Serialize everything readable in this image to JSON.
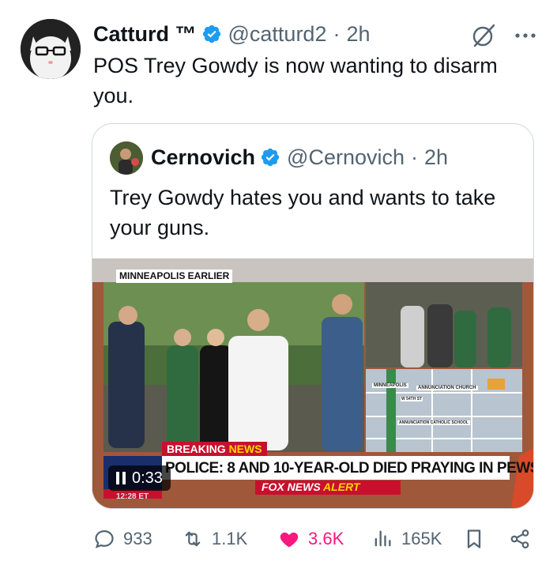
{
  "tweet": {
    "author_name": "Catturd ™",
    "handle": "@catturd2",
    "separator": "·",
    "time": "2h",
    "text": "POS Trey Gowdy is now wanting to disarm you."
  },
  "quote": {
    "author_name": "Cernovich",
    "handle": "@Cernovich",
    "separator": "·",
    "time": "2h",
    "text": "Trey Gowdy hates you and wants to take your guns.",
    "video": {
      "location_tag": "MINNEAPOLIS EARLIER",
      "breaking_label_1": "BREAKING",
      "breaking_label_2": "NEWS",
      "headline": "POLICE: 8 AND 10-YEAR-OLD DIED PRAYING IN PEWS",
      "alert_1": "FOX NEWS",
      "alert_2": "ALERT",
      "clock": "12:28 ET",
      "map_city": "MINNEAPOLIS",
      "map_church": "ANNUNCIATION CHURCH",
      "map_school": "ANNUNCIATION CATHOLIC SCHOOL",
      "map_street": "W 54TH ST",
      "duration": "0:33"
    }
  },
  "actions": {
    "replies": "933",
    "reposts": "1.1K",
    "likes": "3.6K",
    "views": "165K"
  },
  "colors": {
    "verified_blue": "#1d9bf0",
    "like_pink": "#f91880",
    "muted": "#536471",
    "fox_red": "#c8102e"
  },
  "icons": [
    "verified-badge-icon",
    "grok-icon",
    "more-icon",
    "reply-icon",
    "retweet-icon",
    "heart-icon",
    "views-icon",
    "bookmark-icon",
    "share-icon",
    "pause-icon"
  ]
}
